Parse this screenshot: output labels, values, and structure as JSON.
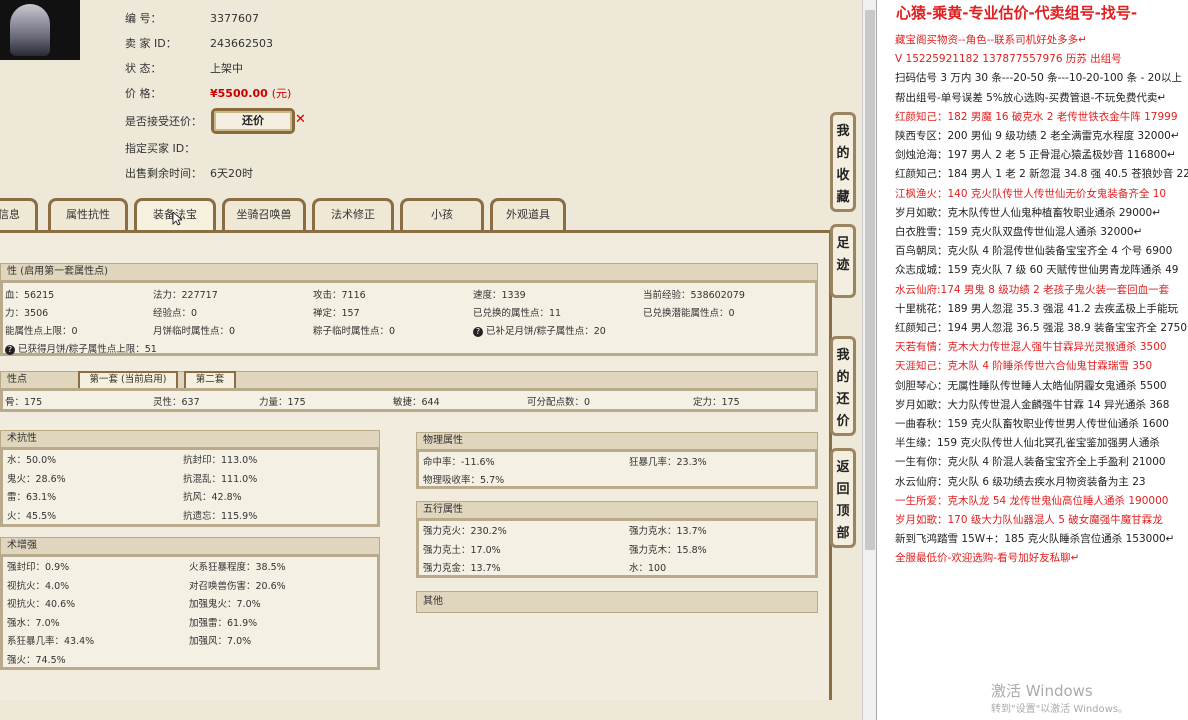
{
  "info": {
    "rows": [
      {
        "key": "编        号：",
        "value": "3377607"
      },
      {
        "key": "卖  家   ID：",
        "value": "243662503"
      },
      {
        "key": "状        态：",
        "value": "上架中"
      },
      {
        "key": "价        格：",
        "value": "¥5500.00",
        "unit": "(元)"
      },
      {
        "key": "是否接受还价：",
        "value": ""
      },
      {
        "key": "指定买家 ID：",
        "value": ""
      },
      {
        "key": "出售剩余时间：",
        "value": "6天20时"
      }
    ],
    "offer_button": "还价"
  },
  "tabs": [
    "信息",
    "属性抗性",
    "装备法宝",
    "坐骑召唤兽",
    "法术修正",
    "小孩",
    "外观道具"
  ],
  "side_buttons": [
    "我的收藏",
    "足迹",
    "我的还价",
    "返回顶部"
  ],
  "attr_header": "性 (启用第一套属性点)",
  "attr_rows": [
    [
      "血：56215",
      "法力：227717",
      "攻击：7116",
      "速度：1339",
      "当前经验：538602079"
    ],
    [
      "力：3506",
      "经验点：0",
      "禅定：157",
      "已兑换的属性点：11",
      "已兑换潜能属性点：0"
    ],
    [
      "能属性点上限：0",
      "月饼临时属性点：0",
      "粽子临时属性点：0",
      "已补足月饼/粽子属性点：20"
    ],
    [
      "已获得月饼/粽子属性点上限：51"
    ]
  ],
  "point_header": "性点",
  "point_tabs": [
    "第一套 (当前启用)",
    "第二套"
  ],
  "point_row": [
    "骨：175",
    "灵性：637",
    "力量：175",
    "敏捷：644",
    "可分配点数：0",
    "定力：175"
  ],
  "resist_header": "术抗性",
  "resist": [
    [
      "水：50.0%",
      "抗封印：113.0%"
    ],
    [
      "鬼火：28.6%",
      "抗混乱：111.0%"
    ],
    [
      "雷：63.1%",
      "抗风：42.8%"
    ],
    [
      "火：45.5%",
      "抗遗忘：115.9%"
    ]
  ],
  "boost_header": "术增强",
  "boost": [
    [
      "强封印：0.9%",
      "火系狂暴程度：38.5%"
    ],
    [
      "视抗火：4.0%",
      "对召唤兽伤害：20.6%"
    ],
    [
      "视抗火：40.6%",
      "加强鬼火：7.0%"
    ],
    [
      "强水：7.0%",
      "加强雷：61.9%"
    ],
    [
      "系狂暴几率：43.4%",
      "加强风：7.0%"
    ],
    [
      "强火：74.5%"
    ]
  ],
  "phys_header": "物理属性",
  "phys": [
    [
      "命中率：-11.6%",
      "狂暴几率：23.3%"
    ],
    [
      "物理吸收率：5.7%"
    ]
  ],
  "wuxing_header": "五行属性",
  "wuxing": [
    [
      "强力克火：230.2%",
      "强力克水：13.7%"
    ],
    [
      "强力克土：17.0%",
      "强力克木：15.8%"
    ],
    [
      "强力克金：13.7%",
      "水：100"
    ]
  ],
  "other_header": "其他",
  "right": {
    "title": "心猿-乘黄-专业估价-代卖组号-找号-",
    "lines": [
      {
        "text": "藏宝阁买物资--角色--联系司机好处多多↵",
        "red": true
      },
      {
        "text": "V 15225921182   137877557976 历苏   出组号",
        "red": true
      },
      {
        "text": "扫码估号 3 万内 30 条---20-50 条---10-20-100 条 - 20以上",
        "red": false
      },
      {
        "text": "帮出组号-单号误差 5%放心选购-买费管退-不玩免费代卖↵",
        "red": false
      },
      {
        "text": "红颜知己：182 男魔 16 破克水 2 老传世铁衣金牛阵 17999",
        "red": true
      },
      {
        "text": "陕西专区：200 男仙 9 级功绩 2 老全满雷克水程度 32000↵",
        "red": false
      },
      {
        "text": "剑烛沧海：197 男人 2 老 5 正骨混心猿孟极妙音 116800↵",
        "red": false
      },
      {
        "text": "红颜知己：184 男人 1 老 2 新忽混 34.8 强 40.5 苍狼妙音 22",
        "red": false
      },
      {
        "text": "江枫渔火：140 克火队传世人传世仙无价女鬼装备齐全 10",
        "red": true
      },
      {
        "text": "岁月如歌：克木队传世人仙鬼种植畜牧职业通杀 29000↵",
        "red": false
      },
      {
        "text": "白衣胜雪：159 克火队双盘传世仙混人通杀 32000↵",
        "red": false
      },
      {
        "text": "百鸟朝凤：克火队 4 阶混传世仙装备宝宝齐全 4 个号 6900",
        "red": false
      },
      {
        "text": "众志成城：159 克火队 7 级 60 天赋传世仙男青龙阵通杀 49",
        "red": false
      },
      {
        "text": "水云仙府:174 男鬼 8 级功绩 2 老孩子鬼火装一套回血一套",
        "red": true
      },
      {
        "text": "十里桃花：189 男人忽混 35.3 强混 41.2 去疾孟极上手能玩",
        "red": false
      },
      {
        "text": "红颜知己：194 男人忽混 36.5 强混 38.9 装备宝宝齐全 2750",
        "red": false
      },
      {
        "text": "天若有情：克木大力传世混人强牛甘霖异光灵猴通杀 3500",
        "red": true
      },
      {
        "text": "天涯知己：克木队 4 阶睡杀传世六合仙鬼甘霖瑞雪 350",
        "red": true
      },
      {
        "text": "剑胆琴心：无属性睡队传世睡人太皓仙阴霾女鬼通杀 5500",
        "red": false
      },
      {
        "text": "岁月如歌：大力队传世混人金麟强牛甘霖 14 异光通杀 368",
        "red": false
      },
      {
        "text": "一曲春秋：159 克火队畜牧职业传世男人传世仙通杀 1600",
        "red": false
      },
      {
        "text": "半生缘：159 克火队传世人仙北冥孔雀宝鉴加强男人通杀",
        "red": false
      },
      {
        "text": "一生有你：克火队 4 阶混人装备宝宝齐全上手盈利 21000",
        "red": false
      },
      {
        "text": "水云仙府：克火队 6 级功绩去疾水月物资装备为主 23",
        "red": false
      },
      {
        "text": "一生所爱：克木队龙 54 龙传世鬼仙高位睡人通杀 190000",
        "red": true
      },
      {
        "text": "岁月如歌：170 级大力队仙器混人 5 破女魔强牛魔甘霖龙",
        "red": true
      },
      {
        "text": "新到飞鸿踏雪 15W+：185 克火队睡杀宫位通杀 153000↵",
        "red": false
      },
      {
        "text": "全服最低价-欢迎选购-看号加好友私聊↵",
        "red": true
      }
    ],
    "watermark": "激活 Windows",
    "watermark_sub": "转到\"设置\"以激活 Windows。"
  }
}
